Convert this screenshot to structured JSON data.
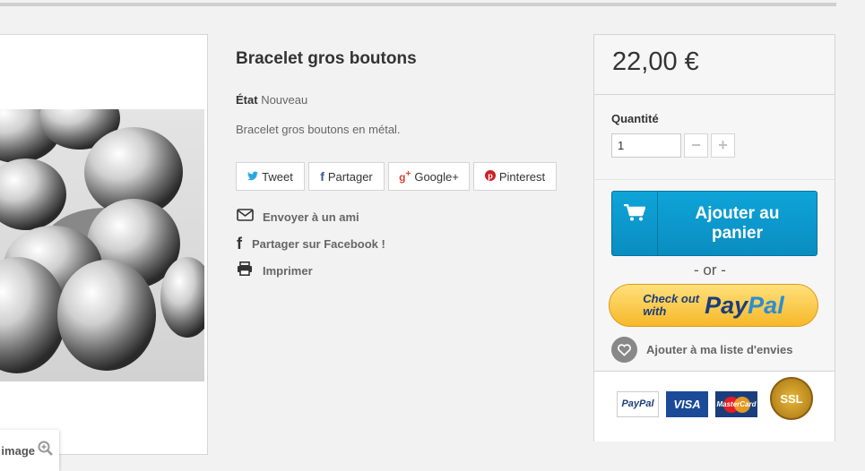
{
  "image_panel": {
    "view_larger_label": "image"
  },
  "product": {
    "title": "Bracelet gros boutons",
    "condition_label": "État",
    "condition_value": "Nouveau",
    "description": "Bracelet gros boutons en métal."
  },
  "social": [
    {
      "label": "Tweet",
      "icon": "twitter-icon",
      "color": "#2aa9e0"
    },
    {
      "label": "Partager",
      "icon": "facebook-icon",
      "color": "#3b5998"
    },
    {
      "label": "Google+",
      "icon": "google-plus-icon",
      "color": "#d34836"
    },
    {
      "label": "Pinterest",
      "icon": "pinterest-icon",
      "color": "#cb2027"
    }
  ],
  "actions": [
    {
      "label": "Envoyer à un ami",
      "icon": "envelope-icon"
    },
    {
      "label": "Partager sur Facebook !",
      "icon": "facebook-icon"
    },
    {
      "label": "Imprimer",
      "icon": "printer-icon"
    }
  ],
  "buy_box": {
    "price": "22,00 €",
    "quantity_label": "Quantité",
    "quantity_value": "1",
    "add_to_cart_label": "Ajouter au panier",
    "or_label": "- or -",
    "paypal_checkout_line1": "Check out",
    "paypal_checkout_line2": "with",
    "paypal_brand_a": "Pay",
    "paypal_brand_b": "Pal",
    "wishlist_label": "Ajouter à ma liste d'envies",
    "accent_color": "#0a93c8"
  },
  "payment_logos": {
    "paypal": "PayPal",
    "visa": "VISA",
    "mastercard": "MasterCard",
    "ssl": "SSL"
  }
}
